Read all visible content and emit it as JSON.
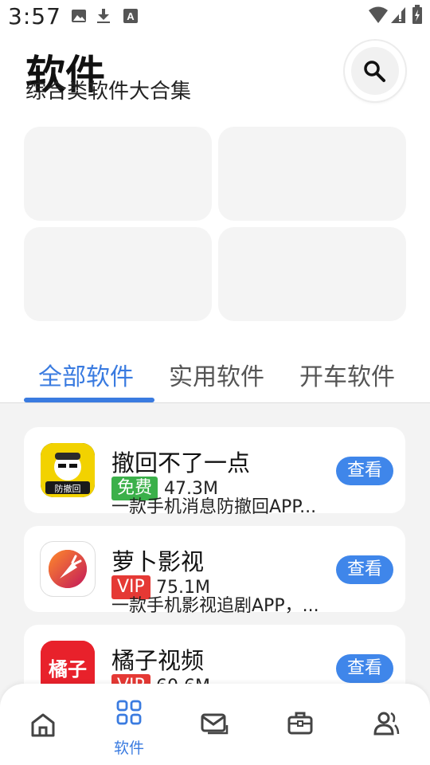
{
  "status_bar": {
    "time": "3:57",
    "icons": [
      "image-icon",
      "download-icon",
      "a-icon",
      "wifi-icon",
      "signal-icon",
      "battery-icon"
    ]
  },
  "header": {
    "title": "软件",
    "subtitle": "综合类软件大合集",
    "search_icon": "search-icon"
  },
  "tabs": [
    {
      "label": "全部软件",
      "active": true
    },
    {
      "label": "实用软件",
      "active": false
    },
    {
      "label": "开车软件",
      "active": false
    }
  ],
  "apps": [
    {
      "name": "撤回不了一点",
      "badge": "免费",
      "badge_color": "#3bb04a",
      "size": "47.3M",
      "desc": "一款手机消息防撤回APP...",
      "button": "查看",
      "icon_text": "防撤回"
    },
    {
      "name": "萝卜影视",
      "badge": "VIP",
      "badge_color": "#e53935",
      "size": "75.1M",
      "desc": "一款手机影视追剧APP，...",
      "button": "查看"
    },
    {
      "name": "橘子视频",
      "badge": "VIP",
      "badge_color": "#e53935",
      "size": "60.6M",
      "desc": "",
      "button": "查看",
      "icon_text": "橘子"
    }
  ],
  "bottom_nav": {
    "items": [
      "home-icon",
      "apps-icon",
      "mail-icon",
      "toolbox-icon",
      "users-icon"
    ],
    "active_label": "软件",
    "active_color": "#3a7be0"
  }
}
